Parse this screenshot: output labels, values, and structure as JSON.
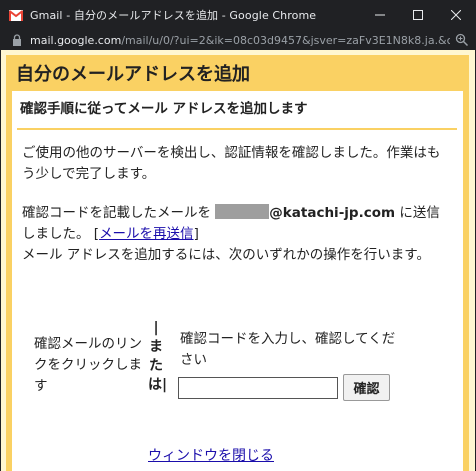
{
  "window": {
    "title": "Gmail - 自分のメールアドレスを追加 - Google Chrome",
    "minimize_icon": "minimize-icon",
    "maximize_icon": "maximize-icon",
    "close_icon": "close-icon"
  },
  "urlbar": {
    "host": "mail.google.com",
    "path": "/mail/u/0/?ui=2&ik=08c03d9457&jsver=zaFv3E1N8k8.ja.&cbl=gmail_..."
  },
  "dialog": {
    "title": "自分のメールアドレスを追加",
    "subtitle": "確認手順に従ってメール アドレスを追加します",
    "paragraph1": "ご使用の他のサーバーを検出し、認証情報を確認しました。作業はもう少しで完了します。",
    "paragraph2_before": "確認コードを記載したメールを",
    "email_domain": "@katachi-jp.com",
    "paragraph2_after": " に送信しました。 [",
    "resend_link": "メールを再送信",
    "paragraph2_close": "]",
    "paragraph3": "メール アドレスを追加するには、次のいずれかの操作を行います。",
    "option1": "確認メールのリンクをクリックします",
    "or_label": "|または|",
    "option2": "確認コードを入力し、確認してください",
    "code_input_value": "",
    "confirm_button": "確認",
    "close_link": "ウィンドウを閉じる"
  },
  "colors": {
    "accent": "#fad163",
    "background": "#fff7d1",
    "link": "#1a0dab"
  }
}
